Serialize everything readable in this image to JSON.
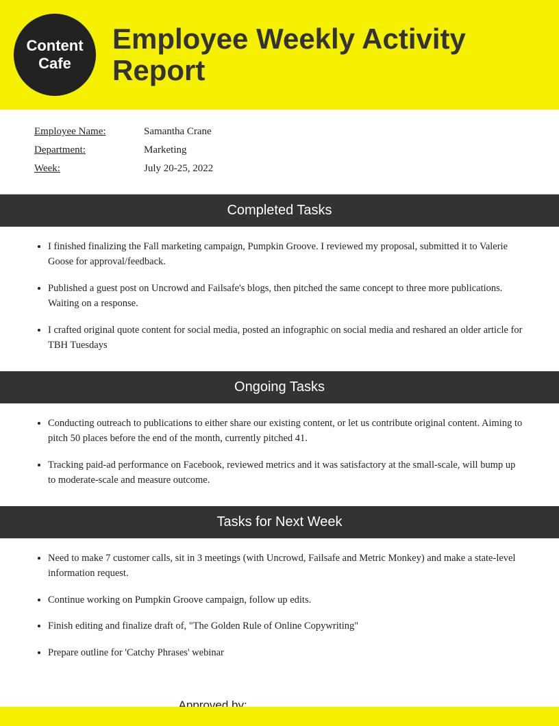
{
  "logo": {
    "line1": "Content",
    "line2": "Cafe"
  },
  "header": {
    "title": "Employee Weekly Activity Report"
  },
  "info": {
    "employee_label": "Employee Name:",
    "employee_value": "Samantha Crane",
    "department_label": "Department:",
    "department_value": "Marketing",
    "week_label": "Week:",
    "week_value": "July 20-25, 2022"
  },
  "sections": {
    "completed": {
      "title": "Completed Tasks",
      "items": [
        "I finished finalizing the Fall marketing campaign, Pumpkin Groove. I reviewed my proposal, submitted it to Valerie Goose for approval/feedback.",
        "Published a guest post on Uncrowd and Failsafe's blogs, then pitched the same concept to three more publications. Waiting on a response.",
        "I crafted original quote content for social media, posted an infographic on social media and reshared an older article for TBH Tuesdays"
      ]
    },
    "ongoing": {
      "title": "Ongoing Tasks",
      "items": [
        "Conducting outreach to publications to either share our existing content, or let us contribute original content. Aiming to pitch 50 places before the end of the month, currently pitched 41.",
        "Tracking paid-ad performance on Facebook, reviewed metrics and it was satisfactory at the small-scale, will bump up to moderate-scale and measure outcome."
      ]
    },
    "next_week": {
      "title": "Tasks for Next Week",
      "items": [
        "Need to make 7 customer calls, sit in 3 meetings (with Uncrowd, Failsafe and Metric Monkey) and make a state-level information request.",
        "Continue working on Pumpkin Groove campaign, follow up edits.",
        "Finish editing and finalize draft of, \"The Golden Rule of Online Copywriting\"",
        "Prepare outline for 'Catchy Phrases' webinar"
      ]
    }
  },
  "approved": {
    "label": "Approved by:"
  }
}
